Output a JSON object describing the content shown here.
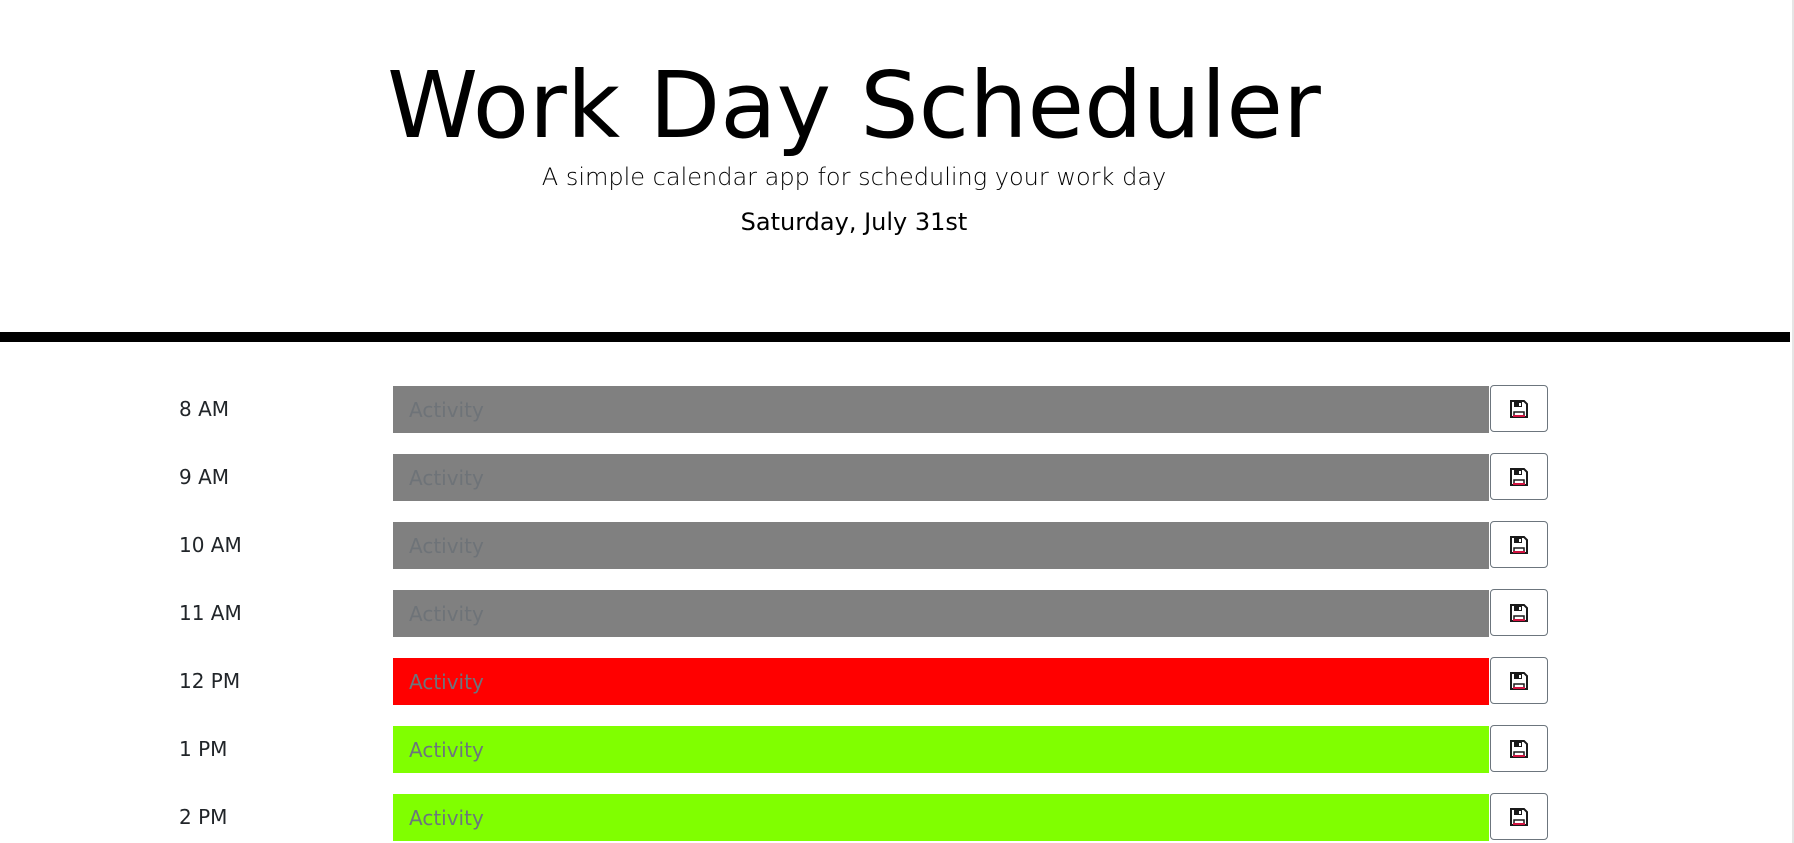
{
  "header": {
    "title": "Work Day Scheduler",
    "lead": "A simple calendar app for scheduling your work day",
    "current_day": "Saturday, July 31st"
  },
  "colors": {
    "past": "#808080",
    "present": "#ff0000",
    "future": "#80ff00",
    "divider": "#000000"
  },
  "rows": [
    {
      "hour": "8 AM",
      "placeholder": "Activity",
      "value": "",
      "state": "past",
      "save_icon": "floppy-disk-icon"
    },
    {
      "hour": "9 AM",
      "placeholder": "Activity",
      "value": "",
      "state": "past",
      "save_icon": "floppy-disk-icon"
    },
    {
      "hour": "10 AM",
      "placeholder": "Activity",
      "value": "",
      "state": "past",
      "save_icon": "floppy-disk-icon"
    },
    {
      "hour": "11 AM",
      "placeholder": "Activity",
      "value": "",
      "state": "past",
      "save_icon": "floppy-disk-icon"
    },
    {
      "hour": "12 PM",
      "placeholder": "Activity",
      "value": "",
      "state": "present",
      "save_icon": "floppy-disk-icon"
    },
    {
      "hour": "1 PM",
      "placeholder": "Activity",
      "value": "",
      "state": "future",
      "save_icon": "floppy-disk-icon"
    },
    {
      "hour": "2 PM",
      "placeholder": "Activity",
      "value": "",
      "state": "future",
      "save_icon": "floppy-disk-icon"
    }
  ]
}
